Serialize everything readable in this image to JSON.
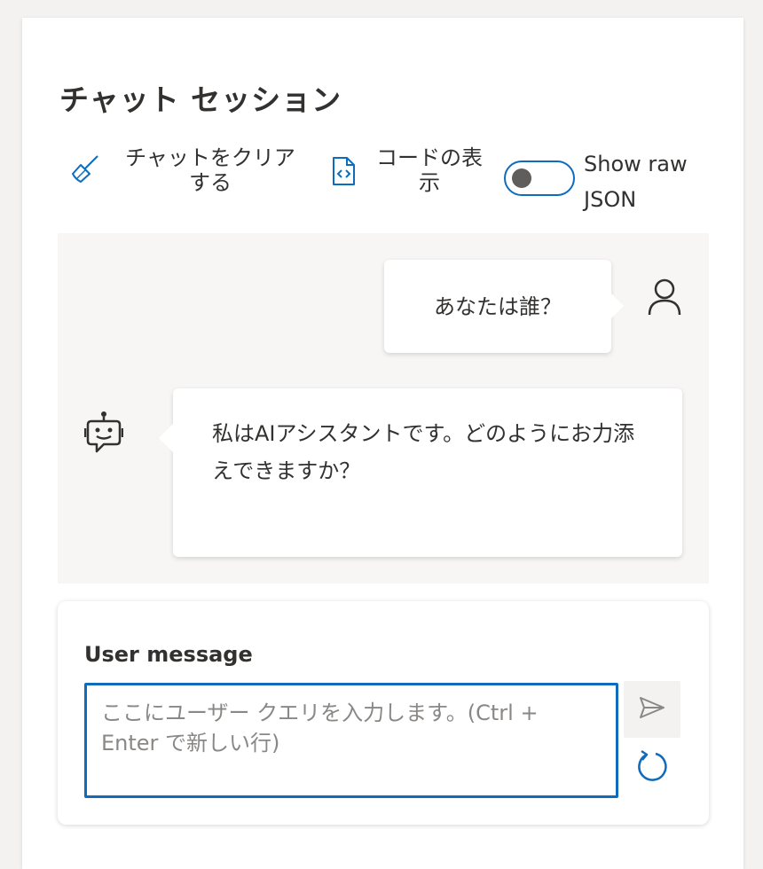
{
  "header": {
    "title": "チャット セッション"
  },
  "toolbar": {
    "clear_label": "チャットをクリアする",
    "code_label": "コードの表示",
    "raw_json_label": "Show raw JSON",
    "raw_json_on": false
  },
  "chat": {
    "messages": [
      {
        "role": "user",
        "text": "あなたは誰？"
      },
      {
        "role": "assistant",
        "text": "私はAIアシスタントです。どのようにお力添えできますか？"
      }
    ]
  },
  "composer": {
    "label": "User message",
    "placeholder": "ここにユーザー クエリを入力します。(Ctrl + Enter で新しい行)",
    "value": ""
  },
  "icons": {
    "clear": "broom-icon",
    "code": "code-file-icon",
    "user": "person-icon",
    "assistant": "bot-icon",
    "send": "send-icon",
    "refresh": "refresh-icon"
  },
  "colors": {
    "accent": "#0f6cbd",
    "text": "#323130",
    "chat_bg": "#f7f6f5"
  }
}
